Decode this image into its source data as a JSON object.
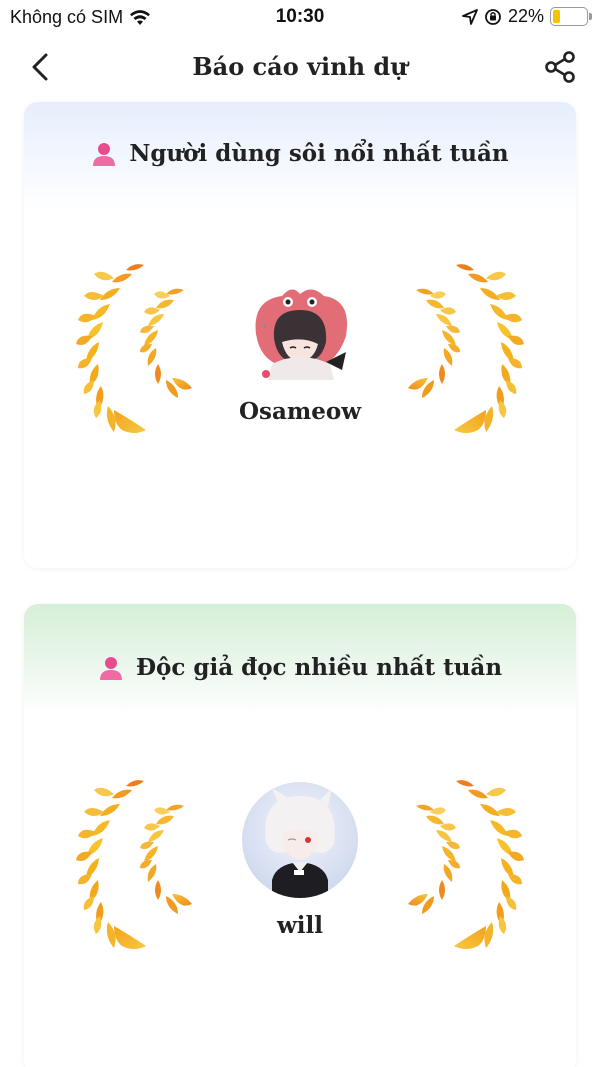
{
  "status_bar": {
    "carrier": "Không có SIM",
    "time": "10:30",
    "battery": "22%",
    "battery_level": 0.22
  },
  "nav": {
    "title": "Báo cáo vinh dự",
    "back_icon": "chevron-left-icon",
    "share_icon": "share-icon"
  },
  "cards": [
    {
      "title": "Người dùng sôi nổi nhất tuần",
      "icon": "user-icon",
      "user": {
        "name": "Osameow"
      }
    },
    {
      "title": "Độc giả đọc nhiều nhất tuần",
      "icon": "user-icon",
      "user": {
        "name": "will"
      }
    }
  ],
  "colors": {
    "accent_pink": "#e94b8f",
    "laurel_gold": "#f6b21c",
    "laurel_orange": "#ef7d1e",
    "card1_header": "#e6eefc",
    "card2_header": "#d6efd7"
  }
}
